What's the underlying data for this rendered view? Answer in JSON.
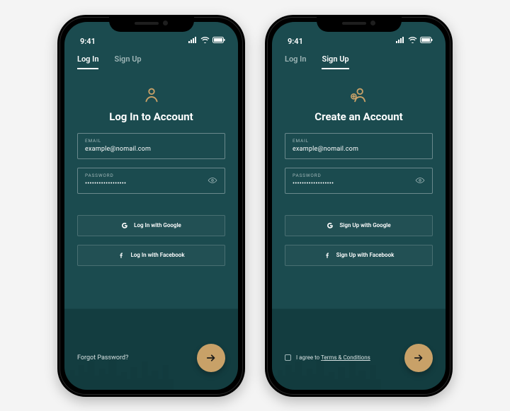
{
  "status": {
    "time": "9:41"
  },
  "tabs": {
    "login": "Log In",
    "signup": "Sign Up"
  },
  "login": {
    "title": "Log In to Account",
    "email_label": "EMAIL",
    "email_value": "example@nomail.com",
    "password_label": "PASSWORD",
    "password_value": "••••••••••••••••••",
    "google_btn": "Log In with Google",
    "facebook_btn": "Log In with Facebook",
    "forgot": "Forgot Password?"
  },
  "signup": {
    "title": "Create an Account",
    "email_label": "EMAIL",
    "email_value": "example@nomail.com",
    "password_label": "PASSWORD",
    "password_value": "••••••••••••••••••",
    "google_btn": "Sign Up with Google",
    "facebook_btn": "Sign Up with Facebook",
    "terms_prefix": "I agree to ",
    "terms_link": "Terms & Conditions"
  },
  "colors": {
    "background": "#1b4b4f",
    "background_bottom": "#133d40",
    "accent": "#c8a168",
    "muted": "#9fb6b7"
  }
}
